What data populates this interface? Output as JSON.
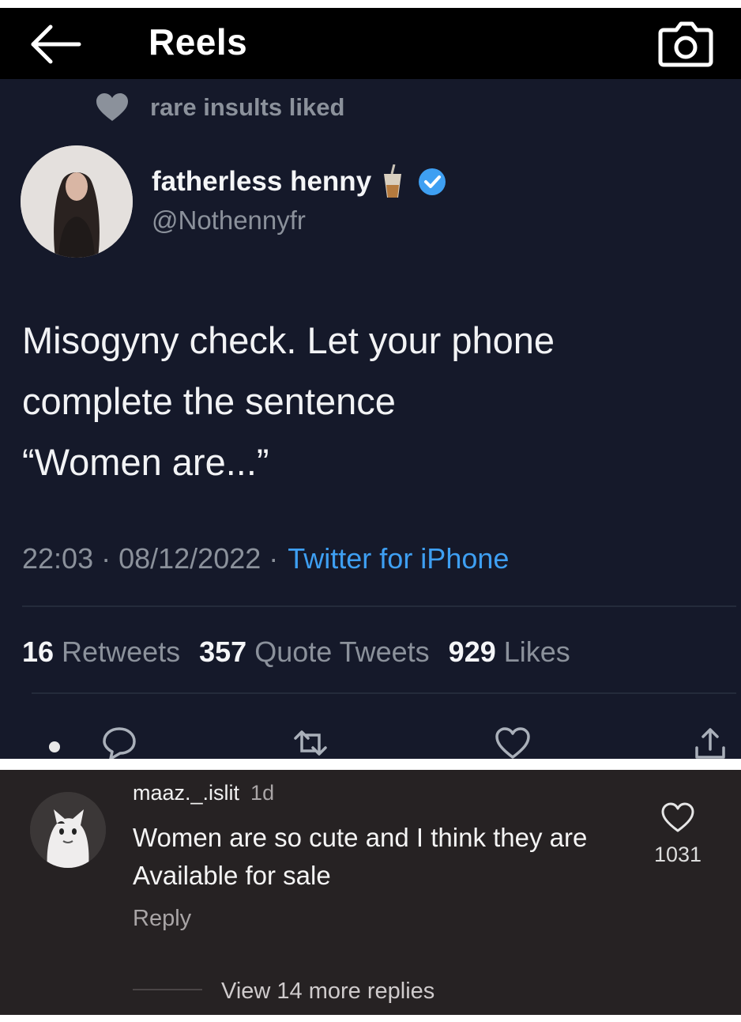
{
  "header": {
    "title": "Reels",
    "back_icon": "arrow-left-icon",
    "camera_icon": "camera-icon"
  },
  "tweet": {
    "liked_by": "rare insults liked",
    "display_name": "fatherless henny",
    "handle": "@Nothennyfr",
    "text": "Misogyny check. Let your phone\ncomplete the sentence\n“Women are...”",
    "time": "22:03",
    "date": "08/12/2022",
    "source": "Twitter for iPhone",
    "stats": {
      "retweets_count": "16",
      "retweets_label": "Retweets",
      "quotes_count": "357",
      "quotes_label": "Quote Tweets",
      "likes_count": "929",
      "likes_label": "Likes"
    },
    "colors": {
      "background": "#15192a",
      "link": "#3e9ff2",
      "verified": "#3e9ff2"
    }
  },
  "comment": {
    "username": "maaz._.islit",
    "time": "1d",
    "text": "Women are so cute and I think they are Available for sale",
    "reply_label": "Reply",
    "likes": "1031",
    "view_replies": "View 14 more replies"
  }
}
